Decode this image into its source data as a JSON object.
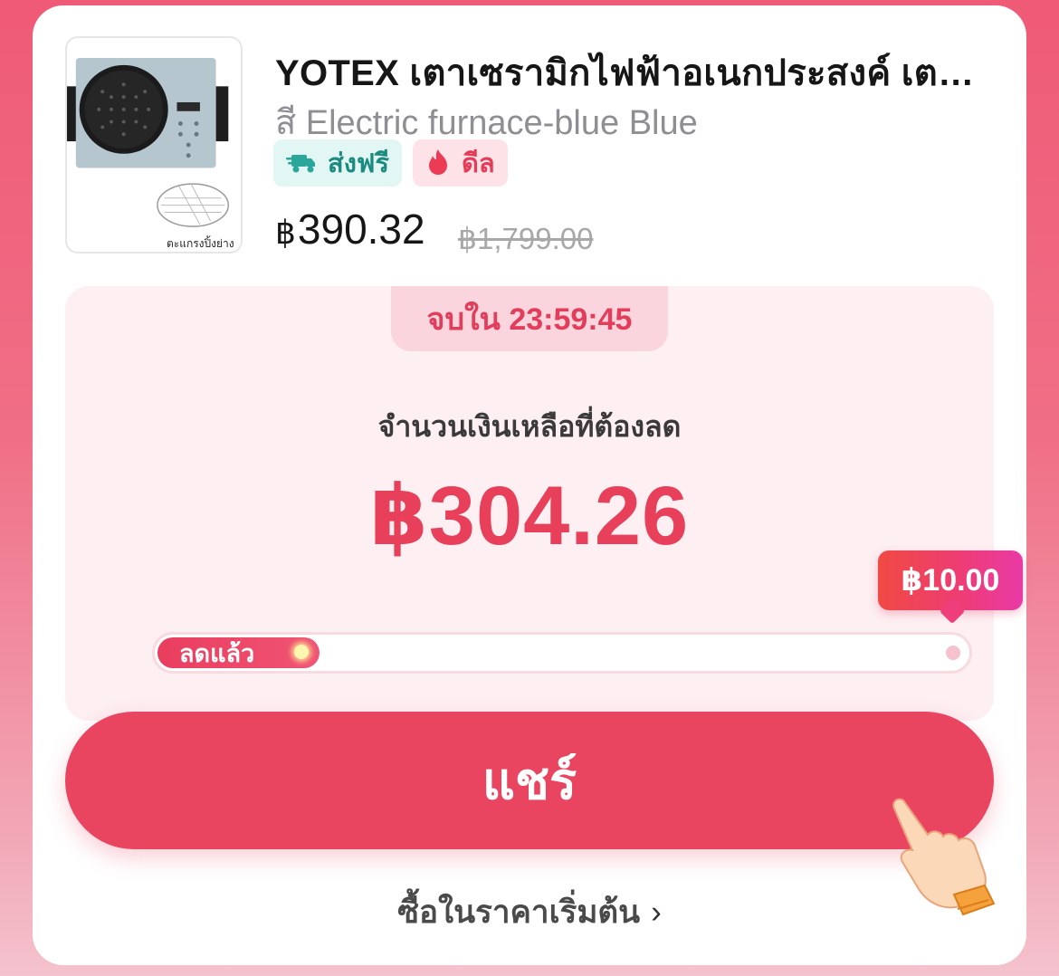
{
  "product": {
    "title": "YOTEX เตาเซรามิกไฟฟ้าอเนกประสงค์ เตาไฟ...",
    "variant": "สี Electric furnace-blue Blue",
    "image_caption": "ตะแกรงปิ้งย่าง",
    "tags": {
      "free_shipping": "ส่งฟรี",
      "deal": "ดีล"
    },
    "currency": "฿",
    "price": "390.32",
    "original_price": "฿1,799.00"
  },
  "bargain": {
    "timer_text": "จบใน 23:59:45",
    "remaining_label": "จำนวนเงินเหลือที่ต้องลด",
    "remaining_amount": "฿304.26",
    "tooltip_amount": "฿10.00",
    "progress_label": "ลดแล้ว",
    "progress_fraction": 0.2
  },
  "actions": {
    "share_label": "แชร์",
    "buy_link_label": "ซื้อในราคาเริ่มต้น",
    "buy_link_chevron": "›"
  },
  "colors": {
    "accent": "#e8405a",
    "background_top": "#ef5a76",
    "free_ship_bg": "#e2f6f3",
    "deal_bg": "#fde3e8"
  },
  "icons": [
    "truck-icon",
    "fire-icon",
    "pointing-hand-icon",
    "chevron-right-icon"
  ]
}
